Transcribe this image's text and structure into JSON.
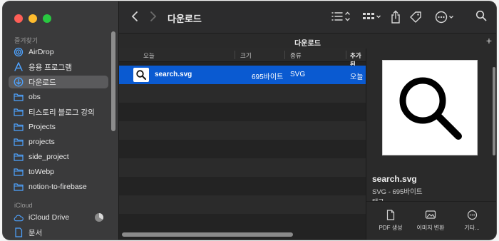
{
  "sidebar": {
    "section_favorites": "즐겨찾기",
    "section_icloud": "iCloud",
    "favorites": [
      {
        "label": "AirDrop",
        "icon": "airdrop-icon"
      },
      {
        "label": "응용 프로그램",
        "icon": "applications-icon"
      },
      {
        "label": "다운로드",
        "icon": "download-icon",
        "selected": true
      },
      {
        "label": "obs",
        "icon": "folder-icon"
      },
      {
        "label": "티스토리 블로그 강의",
        "icon": "folder-icon"
      },
      {
        "label": "Projects",
        "icon": "folder-icon"
      },
      {
        "label": "projects",
        "icon": "folder-icon"
      },
      {
        "label": "side_project",
        "icon": "folder-icon"
      },
      {
        "label": "toWebp",
        "icon": "folder-icon"
      },
      {
        "label": "notion-to-firebase",
        "icon": "folder-icon"
      }
    ],
    "icloud": [
      {
        "label": "iCloud Drive",
        "icon": "cloud-icon"
      },
      {
        "label": "문서",
        "icon": "document-icon"
      }
    ]
  },
  "toolbar": {
    "title": "다운로드"
  },
  "pathbar": {
    "title": "다운로드",
    "add": "+"
  },
  "list": {
    "columns": [
      "오늘",
      "크기",
      "종류",
      "추가된"
    ],
    "rows": [
      {
        "name": "search.svg",
        "size": "695바이트",
        "kind": "SVG",
        "added": "오늘 :"
      }
    ]
  },
  "preview": {
    "name": "search.svg",
    "meta": "SVG - 695바이트",
    "cut_text": "태그",
    "actions": [
      {
        "label": "PDF 생성",
        "icon": "pdf-icon"
      },
      {
        "label": "이미지 변환",
        "icon": "image-convert-icon"
      },
      {
        "label": "기타...",
        "icon": "more-icon"
      }
    ]
  },
  "colors": {
    "selection": "#0a5ad1",
    "sidebar_bg": "#3a3a3b",
    "window_bg": "#232323",
    "light_red": "#fe5f57",
    "light_yellow": "#febc2e",
    "light_green": "#28c840"
  }
}
